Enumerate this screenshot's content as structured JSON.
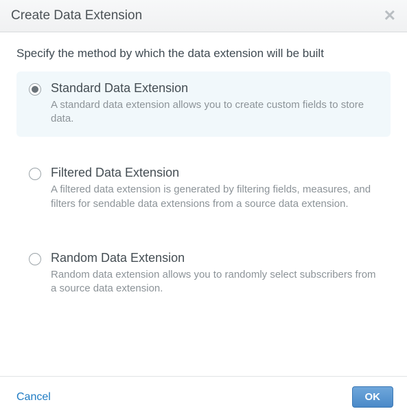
{
  "header": {
    "title": "Create Data Extension"
  },
  "prompt": "Specify the method by which the data extension will be built",
  "options": [
    {
      "title": "Standard Data Extension",
      "desc": "A standard data extension allows you to create custom fields to store data.",
      "selected": true
    },
    {
      "title": "Filtered Data Extension",
      "desc": "A filtered data extension is generated by filtering fields, measures, and filters for sendable data extensions from a source data extension.",
      "selected": false
    },
    {
      "title": "Random Data Extension",
      "desc": "Random data extension allows you to randomly select subscribers from a source data extension.",
      "selected": false
    }
  ],
  "footer": {
    "cancel": "Cancel",
    "ok": "OK"
  }
}
